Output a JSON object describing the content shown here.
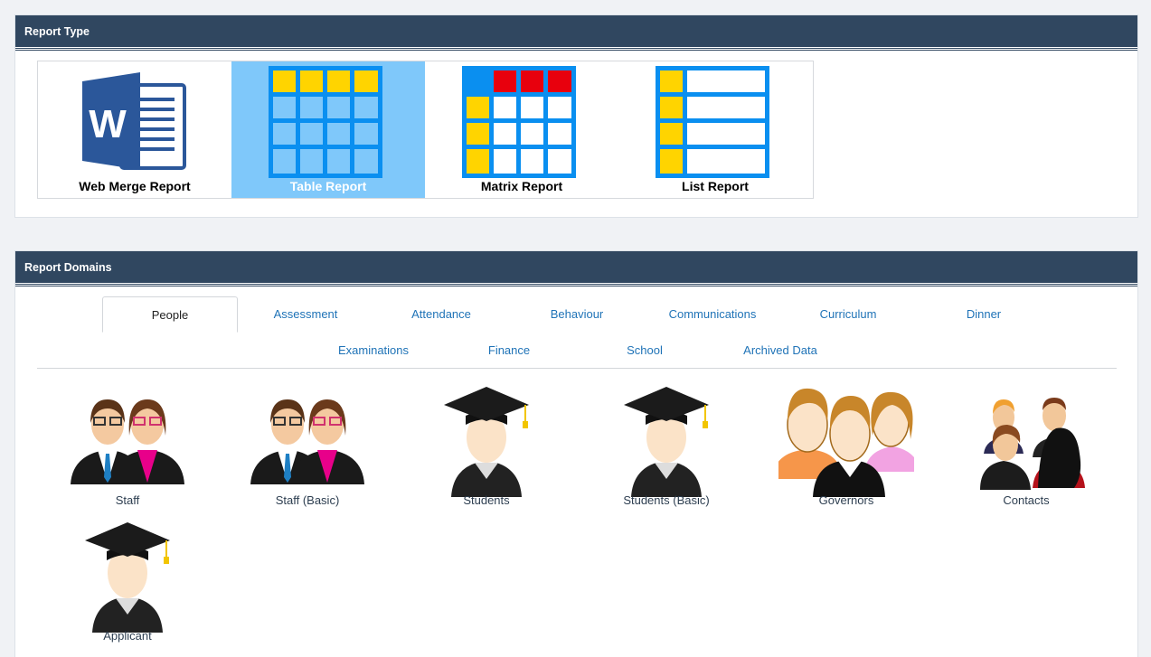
{
  "report_type": {
    "title": "Report Type",
    "cards": [
      {
        "label": "Web Merge Report",
        "icon": "word-document-icon",
        "selected": false
      },
      {
        "label": "Table Report",
        "icon": "table-grid-icon",
        "selected": true
      },
      {
        "label": "Matrix Report",
        "icon": "matrix-grid-icon",
        "selected": false
      },
      {
        "label": "List Report",
        "icon": "list-grid-icon",
        "selected": false
      }
    ]
  },
  "report_domains": {
    "title": "Report Domains",
    "tabs": [
      {
        "label": "People",
        "active": true
      },
      {
        "label": "Assessment"
      },
      {
        "label": "Attendance"
      },
      {
        "label": "Behaviour"
      },
      {
        "label": "Communications"
      },
      {
        "label": "Curriculum"
      },
      {
        "label": "Dinner"
      },
      {
        "label": "Examinations"
      },
      {
        "label": "Finance"
      },
      {
        "label": "School"
      },
      {
        "label": "Archived Data"
      }
    ],
    "items": [
      {
        "label": "Staff",
        "icon": "staff-icon"
      },
      {
        "label": "Staff (Basic)",
        "icon": "staff-icon"
      },
      {
        "label": "Students",
        "icon": "graduate-icon"
      },
      {
        "label": "Students (Basic)",
        "icon": "graduate-icon"
      },
      {
        "label": "Governors",
        "icon": "group-icon"
      },
      {
        "label": "Contacts",
        "icon": "contacts-icon"
      },
      {
        "label": "Applicant",
        "icon": "graduate-icon"
      }
    ]
  },
  "colors": {
    "header_bg": "#304760",
    "selected_card": "#7fc8fa",
    "link": "#1f73b7",
    "grid_blue": "#0a8ff0",
    "cell_yellow": "#ffd400",
    "cell_red": "#e8000d",
    "word_blue": "#2b579a"
  }
}
